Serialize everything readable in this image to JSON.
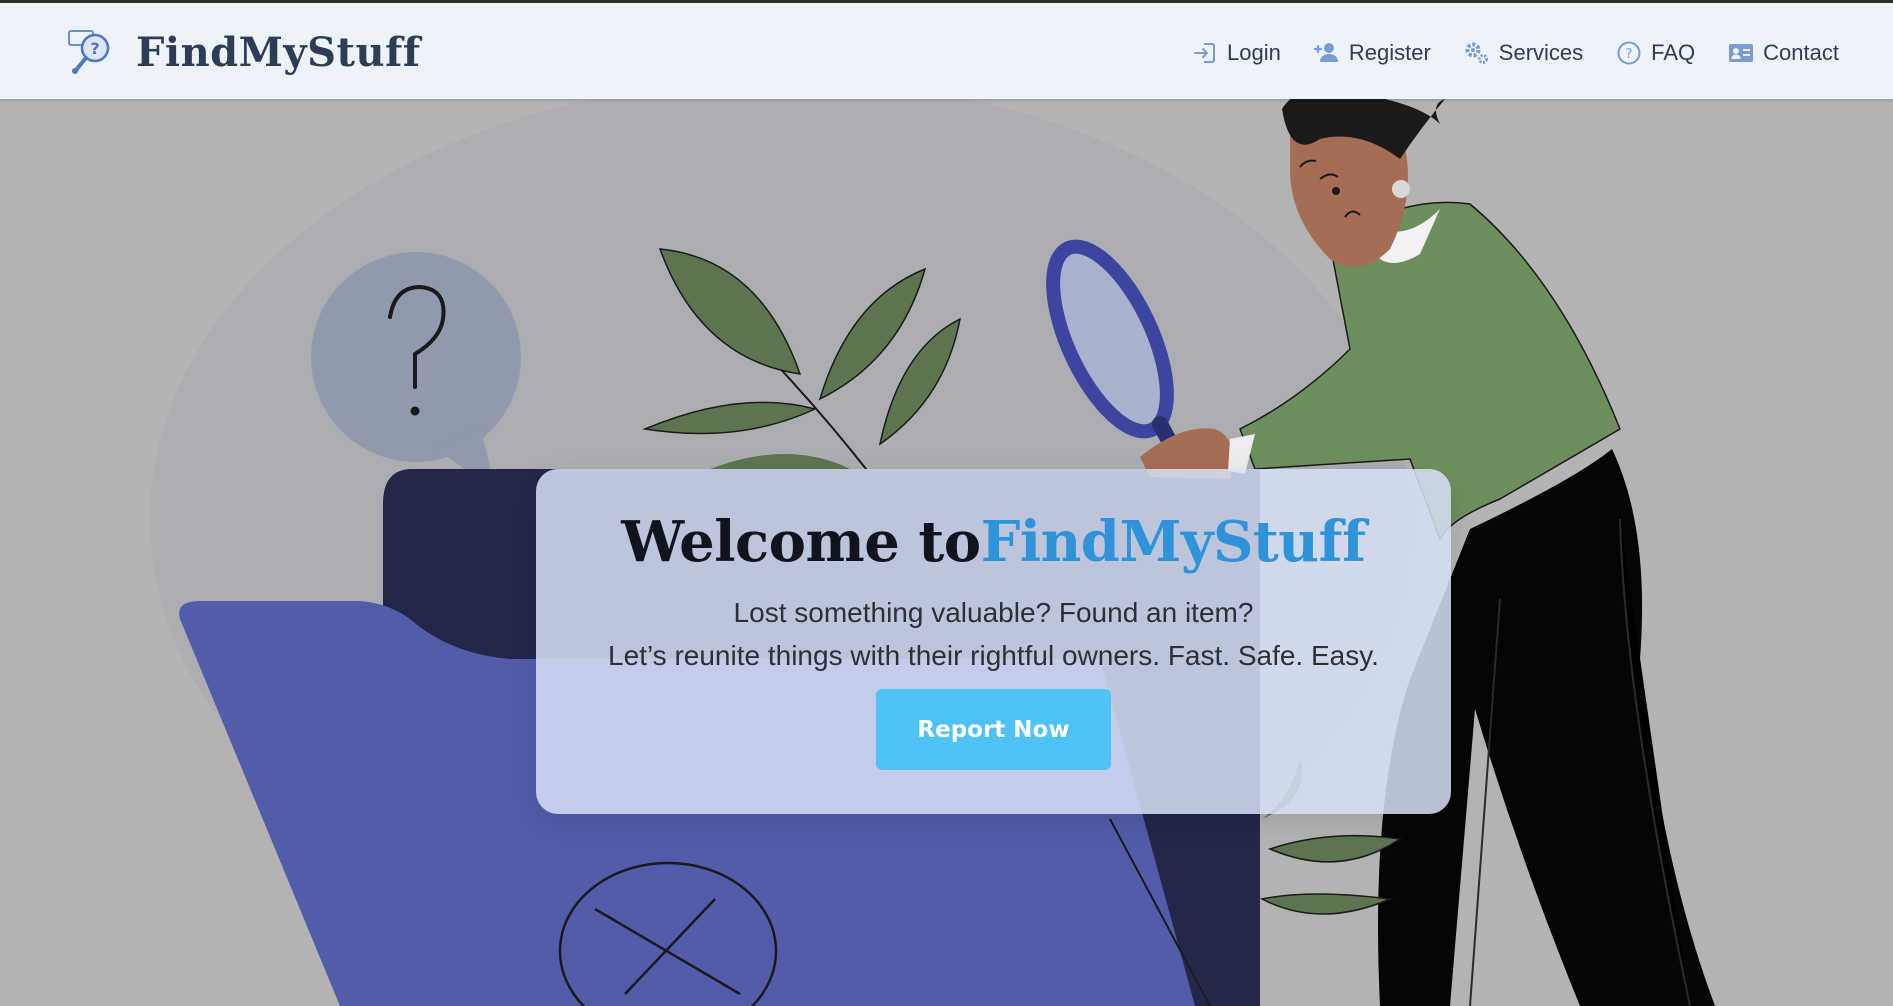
{
  "brand": {
    "name": "FindMyStuff",
    "logo_icon": "magnifier-question-icon"
  },
  "nav": [
    {
      "label": "Login",
      "icon": "login-icon"
    },
    {
      "label": "Register",
      "icon": "user-plus-icon"
    },
    {
      "label": "Services",
      "icon": "gears-icon"
    },
    {
      "label": "FAQ",
      "icon": "question-circle-icon"
    },
    {
      "label": "Contact",
      "icon": "contact-card-icon"
    }
  ],
  "hero": {
    "welcome_prefix": "Welcome to",
    "welcome_brand": "FindMyStuff",
    "tagline_line1": "Lost something valuable? Found an item?",
    "tagline_line2": "Let’s reunite things with their rightful owners. Fast. Safe. Easy.",
    "cta_label": "Report Now",
    "illustration": "woman-searching-with-magnifier-illustration"
  },
  "colors": {
    "navbar_bg": "#eef2f9",
    "brand_text": "#2e3d56",
    "accent_blue": "#2f93d9",
    "cta_bg": "#4fc1f4",
    "icon_blue": "#7a9bd4"
  }
}
